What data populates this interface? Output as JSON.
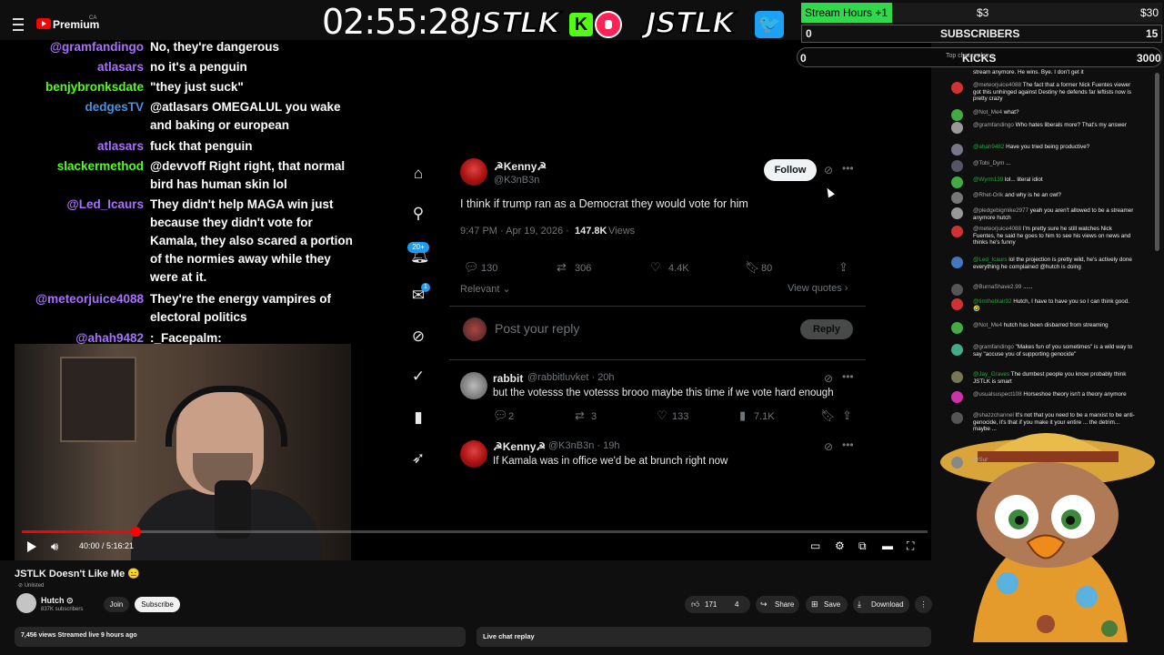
{
  "topbar": {
    "brand": "Premium",
    "brand_sup": "CA"
  },
  "overlay": {
    "timer": "02:55:28",
    "logo_text": "JSTLK",
    "logo_text2": "JSTLK",
    "k_letter": "K",
    "bird": "🐦",
    "stream_hours_label": "Stream Hours +1",
    "price1": "$3",
    "price2": "$30",
    "subs_count": "0",
    "subs_label": "SUBSCRIBERS",
    "subs_right": "15",
    "kicks_count": "0",
    "kicks_label": "KICKS",
    "kicks_right": "3000"
  },
  "stream_chat": [
    {
      "name": "@gramfandingo",
      "color": "#a970ff",
      "text": "No, they're dangerous"
    },
    {
      "name": "atlasars",
      "color": "#a970ff",
      "text": "no it's a penguin"
    },
    {
      "name": "benjybronksdate",
      "color": "#53fc18",
      "text": "\"they just suck\""
    },
    {
      "name": "dedgesTV",
      "color": "#4a90e2",
      "text": "@atlasars OMEGALUL you wake\nand baking or european"
    },
    {
      "name": "atlasars",
      "color": "#a970ff",
      "text": "fuck that penguin"
    },
    {
      "name": "slackermethod",
      "color": "#53fc18",
      "text": "@devvoff Right right, that normal\nbird has human skin lol"
    },
    {
      "name": "@Led_Icaurs",
      "color": "#a970ff",
      "text": "They didn't help MAGA win just\nbecause they didn't vote for\nKamala, they also scared a portion\nof the normies away while they\nwere at it."
    },
    {
      "name": "@meteorjuice4088",
      "color": "#a970ff",
      "text": "They're the energy vampires of\nelectoral politics"
    },
    {
      "name": "@ahah9482",
      "color": "#a970ff",
      "text": ":_Facepalm:"
    }
  ],
  "tweet": {
    "name": "☭Kenny☭",
    "handle": "@K3nB3n",
    "follow": "Follow",
    "text": "I think if trump ran as a Democrat they would vote for him",
    "time": "9:47 PM · Apr 19, 2026 ·",
    "views_n": "147.8K",
    "views_l": "Views",
    "replies": "130",
    "reposts": "306",
    "likes": "4.4K",
    "bookmarks": "80",
    "relevant": "Relevant ⌄",
    "view_quotes": "View quotes ›",
    "reply_placeholder": "Post your reply",
    "reply_button": "Reply",
    "badge": "20+",
    "badge2": "1"
  },
  "reply1": {
    "name": "rabbit",
    "handle": "@rabbitluvket · 20h",
    "text": "but the votesss the votesss brooo maybe this time if we vote hard enough",
    "replies": "2",
    "reposts": "3",
    "likes": "133",
    "views": "7.1K"
  },
  "reply2": {
    "name": "☭Kenny☭",
    "handle": "@K3nB3n · 19h",
    "text": "If Kamala was in office we'd be at brunch right now"
  },
  "player": {
    "time": "40:00 / 5:16:21"
  },
  "video_info": {
    "title": "JSTLK Doesn't Like Me 😑",
    "unlisted": "⊘ Unlisted",
    "channel": "Hutch ⊙",
    "subs": "837K subscribers",
    "join": "Join",
    "subscribe": "Subscribe",
    "likes": "171",
    "dislikes": "4",
    "share": "Share",
    "save": "Save",
    "download": "Download",
    "meta": "7,456 views  Streamed live 9 hours ago",
    "live_chat_replay": "Live chat replay"
  },
  "yt_chat": {
    "header": "Top chat replay ⌄",
    "messages": [
      {
        "name": "",
        "cls": "",
        "text": "stream anymore. He wins. Bye. I don't get it"
      },
      {
        "name": "@meteorjuice4088",
        "cls": "",
        "text": "The fact that a former Nick Fuentes viewer got this unhinged against Destiny he defends far leftists now is pretty crazy"
      },
      {
        "name": "@Not_Me4",
        "cls": "",
        "text": "what?"
      },
      {
        "name": "@gramfandingo",
        "cls": "",
        "text": "Who hates liberals more? That's my answer"
      },
      {
        "name": "@ahah9482",
        "cls": "g",
        "text": "Have you tried being productive?"
      },
      {
        "name": "@Tobi_Dym",
        "cls": "",
        "text": "..."
      },
      {
        "name": "@Wyrm139",
        "cls": "g",
        "text": "lol... literal idiot"
      },
      {
        "name": "@Rhet-Orik",
        "cls": "",
        "text": "and why is he an owl?"
      },
      {
        "name": "@pledgebigmike2977",
        "cls": "",
        "text": "yeah you aren't allowed to be a streamer anymore hutch"
      },
      {
        "name": "@meteorjuice4088",
        "cls": "",
        "text": "I'm pretty sure he still watches Nick Fuentes, he said he goes to him to see his views on news and thinks he's funny"
      },
      {
        "name": "@Led_Icaurs",
        "cls": "g",
        "text": "lol the projection is pretty wild, he's actively done everything he complained @hutch is doing"
      },
      {
        "name": "@BurnaShave2.99",
        "cls": "",
        "text": "......"
      },
      {
        "name": "@timtheblair92",
        "cls": "g",
        "text": "Hutch, I have to have you so I can think good. 🤣"
      },
      {
        "name": "@Not_Me4",
        "cls": "",
        "text": "hutch has been disbarred from streaming"
      },
      {
        "name": "@gramfandingo",
        "cls": "",
        "text": "\"Makes fun of you sometimes\" is a wild way to say \"accuse you of supporting genocide\""
      },
      {
        "name": "@Jay_Graves",
        "cls": "g",
        "text": "The dumbest people you know probably think JSTLK is smart"
      },
      {
        "name": "@usualsuspect108",
        "cls": "",
        "text": "Horseshoe theory isn't a theory anymore"
      },
      {
        "name": "@shazzchannel",
        "cls": "",
        "text": "It's not that you need to be a marxist to be anti-genocide, it's that if you make it your entire ... the detrim... maybe ..."
      },
      {
        "name": "@Sur",
        "cls": "",
        "text": ""
      }
    ]
  },
  "colors": {
    "accent": "#ff0000",
    "kick_green": "#53fc18",
    "twitter_blue": "#1d9bf0"
  }
}
